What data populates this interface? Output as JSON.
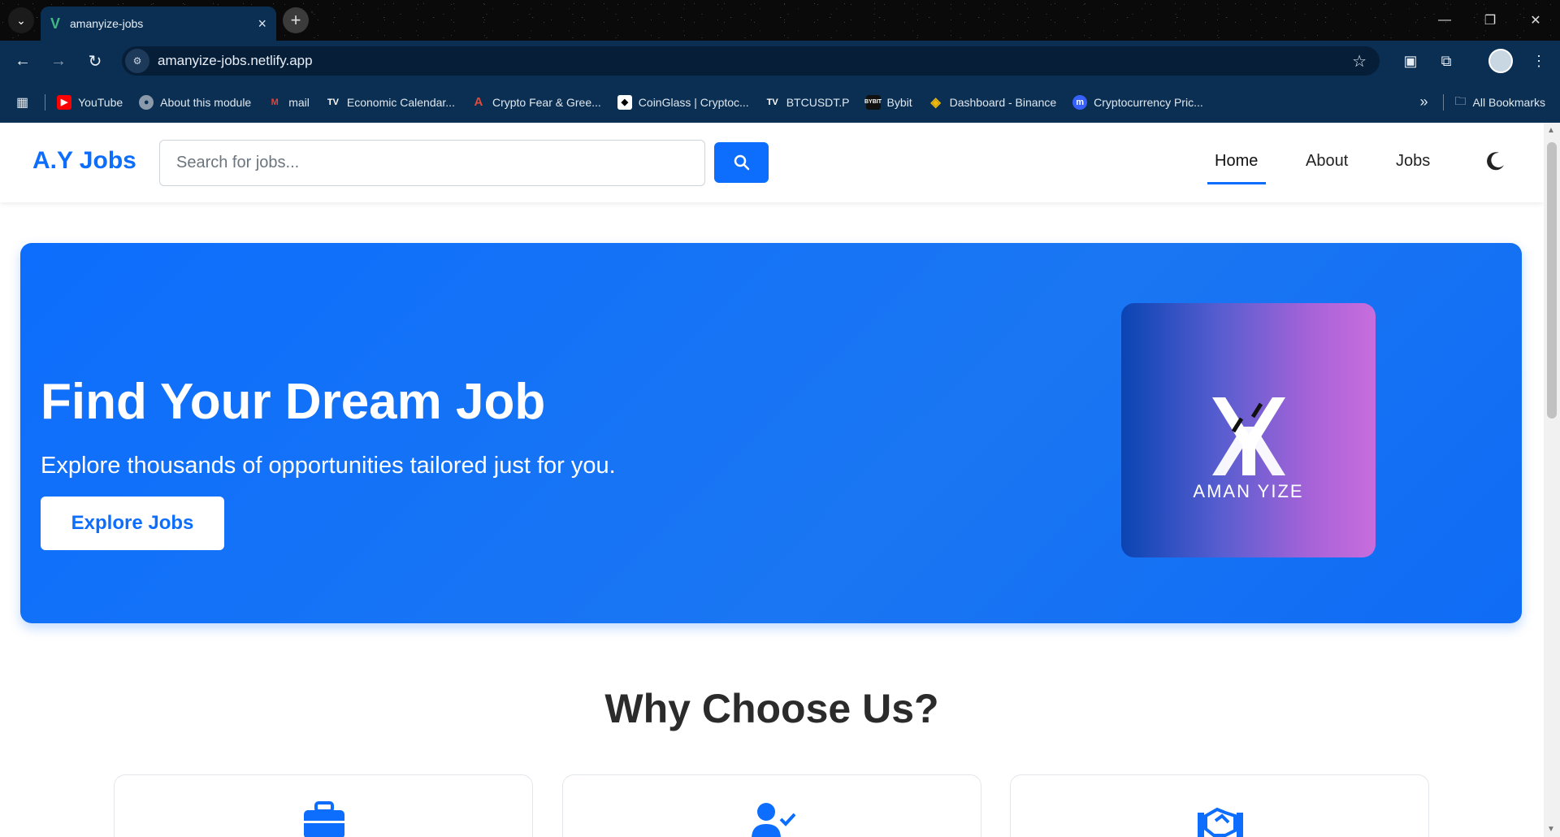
{
  "browser": {
    "tab_title": "amanyize-jobs",
    "url": "amanyize-jobs.netlify.app",
    "bookmarks": [
      {
        "label": "YouTube",
        "icon": "youtube-icon",
        "color": "#ff0000"
      },
      {
        "label": "About this module",
        "icon": "globe-icon",
        "color": "#8a9aaa"
      },
      {
        "label": "mail",
        "icon": "gmail-icon",
        "color": "#ea4335"
      },
      {
        "label": "Economic Calendar...",
        "icon": "tradingview-icon",
        "color": "#ffffff"
      },
      {
        "label": "Crypto Fear & Gree...",
        "icon": "alternative-icon",
        "color": "#e04a3a"
      },
      {
        "label": "CoinGlass | Cryptoc...",
        "icon": "coinglass-icon",
        "color": "#ffffff"
      },
      {
        "label": "BTCUSDT.P",
        "icon": "tradingview-icon",
        "color": "#ffffff"
      },
      {
        "label": "Bybit",
        "icon": "bybit-icon",
        "color": "#ffffff"
      },
      {
        "label": "Dashboard - Binance",
        "icon": "binance-icon",
        "color": "#f0b90b"
      },
      {
        "label": "Cryptocurrency Pric...",
        "icon": "coinmarketcap-icon",
        "color": "#3861fb"
      }
    ],
    "all_bookmarks": "All Bookmarks"
  },
  "header": {
    "brand": "A.Y Jobs",
    "search_placeholder": "Search for jobs...",
    "nav": [
      "Home",
      "About",
      "Jobs"
    ],
    "active_nav": "Home"
  },
  "hero": {
    "title": "Find Your Dream Job",
    "subtitle": "Explore thousands of opportunities tailored just for you.",
    "button": "Explore Jobs",
    "logo_text": "AMAN YIZE"
  },
  "why": {
    "title": "Why Choose Us?",
    "cards": [
      {
        "icon": "briefcase-icon"
      },
      {
        "icon": "user-check-icon"
      },
      {
        "icon": "handshake-icon"
      }
    ]
  },
  "colors": {
    "primary": "#0d6efd",
    "chrome": "#0b2f52"
  }
}
